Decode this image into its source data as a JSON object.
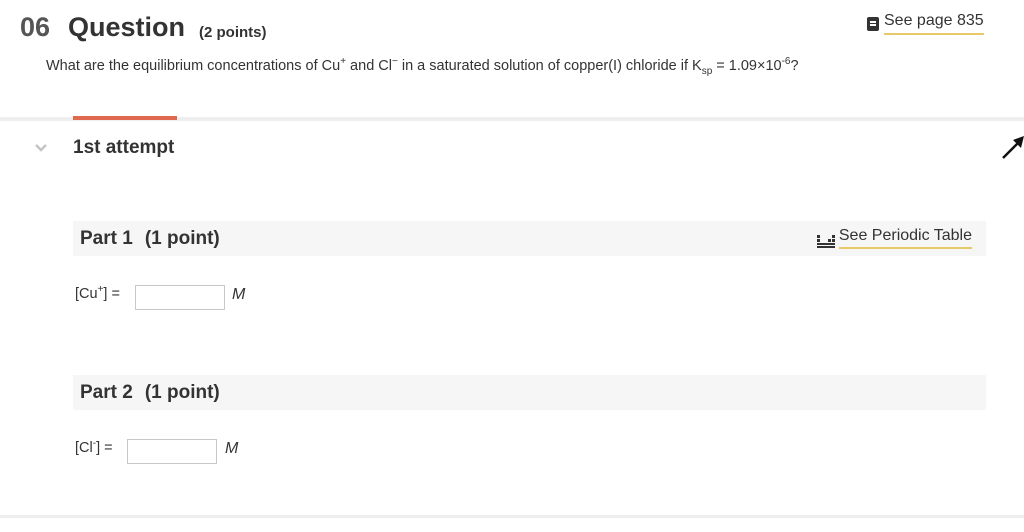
{
  "question": {
    "number": "06",
    "title": "Question",
    "points": "(2 points)",
    "see_page_label": "See page 835",
    "text_before_cu": "What are the equilibrium concentrations of Cu",
    "cu_charge": "+",
    "text_mid": " and Cl",
    "cl_charge": "−",
    "text_after_cl": " in a saturated solution of copper(I) chloride if K",
    "ksp_sub": "sp",
    "ksp_value": " = 1.09×10",
    "ksp_exp": "-6",
    "text_end": "?"
  },
  "attempt": {
    "label": "1st attempt"
  },
  "part1": {
    "label": "Part 1",
    "points": "(1 point)",
    "periodic_label": "See Periodic Table",
    "answer_prefix": "[Cu",
    "answer_charge": "+",
    "answer_suffix": "] =",
    "value": "",
    "unit": "M"
  },
  "part2": {
    "label": "Part 2",
    "points": "(1 point)",
    "answer_prefix": "[Cl",
    "answer_charge": "-",
    "answer_suffix": "] =",
    "value": "",
    "unit": "M"
  },
  "colors": {
    "accent": "#e06a4f",
    "underline": "#e8c96a",
    "part_bg": "#f6f6f6"
  },
  "icons": {
    "see_page": "book-icon",
    "periodic": "periodic-table-icon",
    "collapse": "chevron-down-icon"
  }
}
